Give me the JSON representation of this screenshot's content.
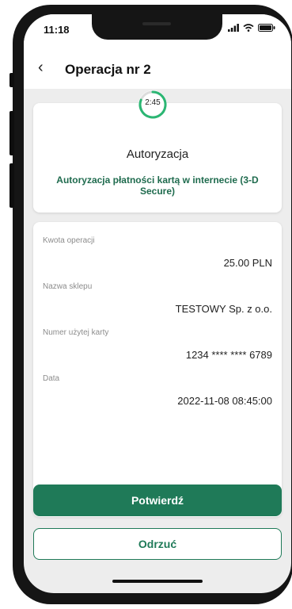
{
  "status_bar": {
    "time": "11:18"
  },
  "header": {
    "back_icon": "chevron-left-icon",
    "title": "Operacja nr 2"
  },
  "auth": {
    "timer": "2:45",
    "title": "Autoryzacja",
    "subtitle": "Autoryzacja płatności kartą w internecie (3-D Secure)"
  },
  "details": [
    {
      "label": "Kwota operacji",
      "value": "25.00 PLN"
    },
    {
      "label": "Nazwa sklepu",
      "value": "TESTOWY Sp. z o.o."
    },
    {
      "label": "Numer użytej karty",
      "value": "1234 **** **** 6789"
    },
    {
      "label": "Data",
      "value": "2022-11-08 08:45:00"
    }
  ],
  "actions": {
    "confirm": "Potwierdź",
    "reject": "Odrzuć"
  },
  "colors": {
    "brand_green": "#1f7a58",
    "accent_green": "#2bb673"
  }
}
